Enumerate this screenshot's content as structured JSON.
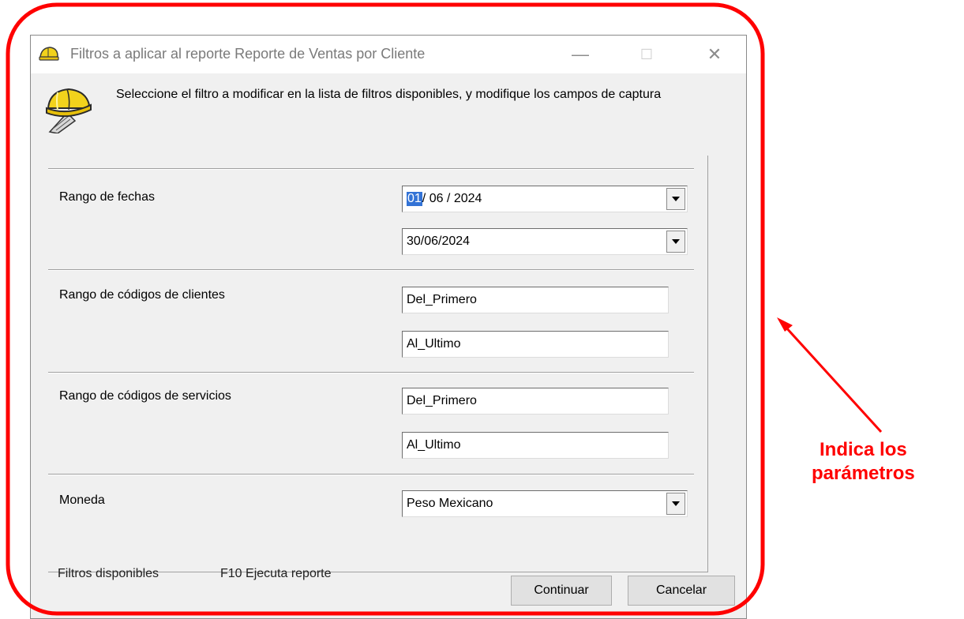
{
  "window": {
    "title": "Filtros a aplicar al reporte Reporte de Ventas por Cliente",
    "minimize_glyph": "—",
    "maximize_glyph": "☐",
    "close_glyph": "✕",
    "icon": "hardhat-icon"
  },
  "header": {
    "text": "Seleccione el filtro a modificar  en la lista de filtros disponibles, y modifique los campos de  captura",
    "icon": "hardhat-scroll-icon"
  },
  "filters": {
    "dates": {
      "label": "Rango de fechas",
      "from_day": "01",
      "from_rest": "/ 06 / 2024",
      "to": "30/06/2024"
    },
    "clients": {
      "label": "Rango de códigos de clientes",
      "from": "Del_Primero",
      "to": "Al_Ultimo"
    },
    "services": {
      "label": "Rango de códigos de servicios",
      "from": "Del_Primero",
      "to": "Al_Ultimo"
    },
    "currency": {
      "label": "Moneda",
      "value": "Peso Mexicano"
    }
  },
  "footer": {
    "available_filters": "Filtros disponibles",
    "f10_hint": "F10 Ejecuta reporte",
    "continue_label": "Continuar",
    "cancel_label": "Cancelar"
  },
  "annotation": {
    "line1": "Indica los",
    "line2": "parámetros",
    "color": "#ff0000"
  }
}
